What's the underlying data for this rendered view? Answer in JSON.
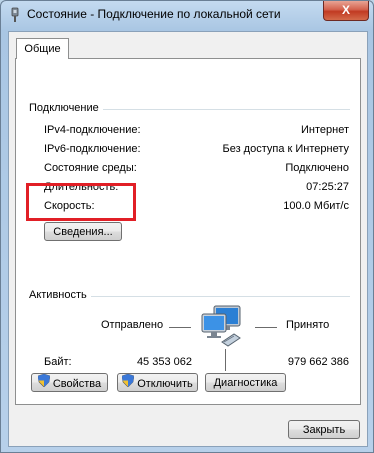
{
  "window": {
    "title": "Состояние - Подключение по локальной сети",
    "close_label": "X"
  },
  "tabs": [
    {
      "label": "Общие"
    }
  ],
  "connection": {
    "group_label": "Подключение",
    "rows": [
      {
        "label": "IPv4-подключение:",
        "value": "Интернет"
      },
      {
        "label": "IPv6-подключение:",
        "value": "Без доступа к Интернету"
      },
      {
        "label": "Состояние среды:",
        "value": "Подключено"
      },
      {
        "label": "Длительность:",
        "value": "07:25:27"
      },
      {
        "label": "Скорость:",
        "value": "100.0 Мбит/с"
      }
    ],
    "details_button": "Сведения..."
  },
  "activity": {
    "group_label": "Активность",
    "sent_label": "Отправлено",
    "received_label": "Принято",
    "bytes_label": "Байт:",
    "bytes_sent": "45 353 062",
    "bytes_received": "979 662 386"
  },
  "buttons": {
    "properties": "Свойства",
    "disable": "Отключить",
    "diagnose": "Диагностика",
    "close": "Закрыть"
  },
  "colors": {
    "highlight": "#e11f26"
  }
}
